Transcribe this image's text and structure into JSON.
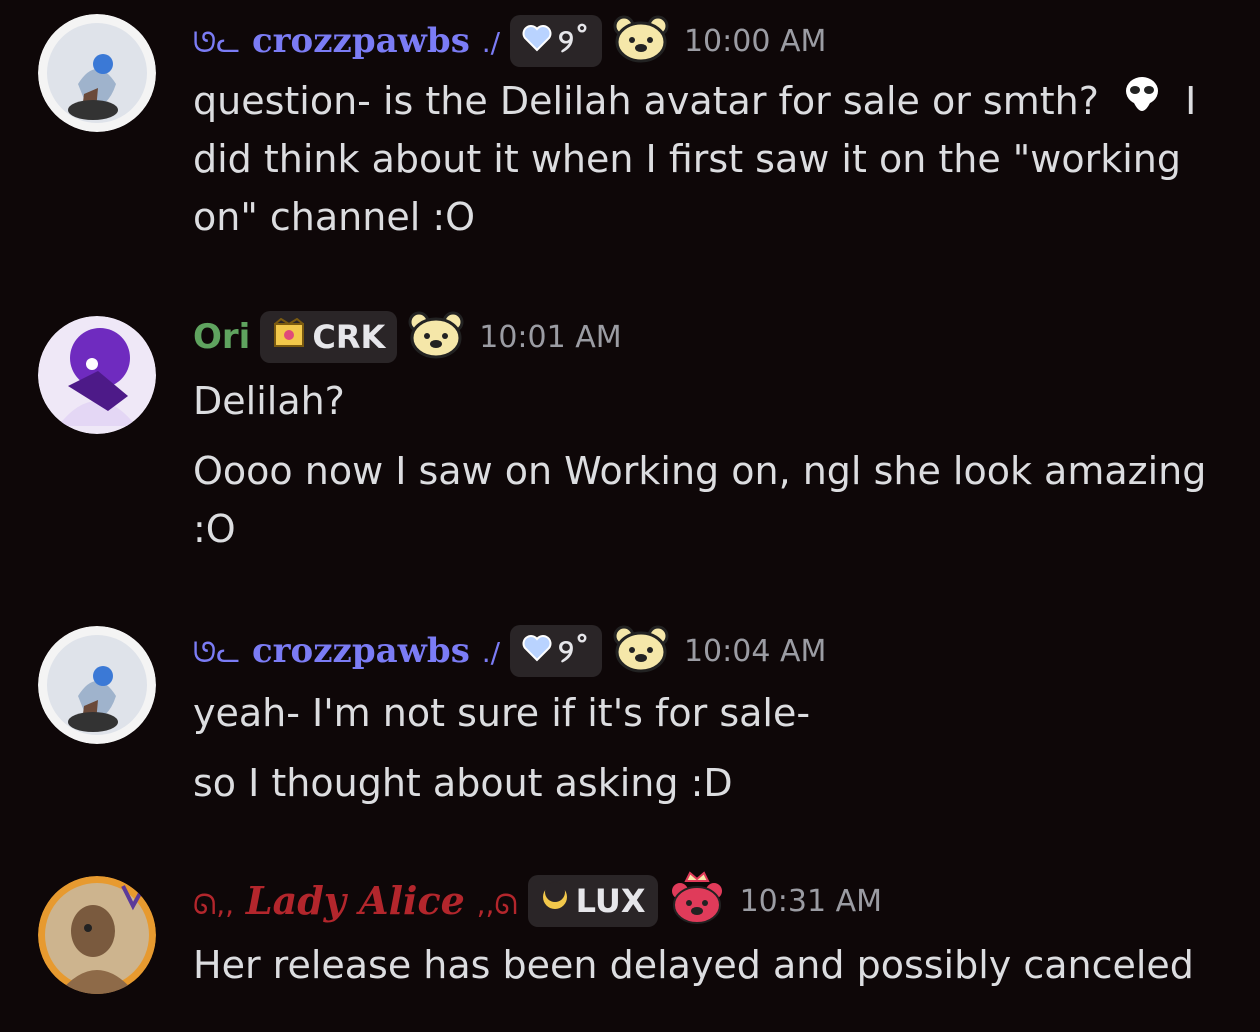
{
  "messages": [
    {
      "username": "crozzpawbs",
      "username_prefix": "ᘎᓚ",
      "username_suffix": "./",
      "name_color": "#7b7cf5",
      "tag_text": "୨˚",
      "tag_icon": "heart-icon",
      "badge_icon": "bear-face-icon",
      "time": "10:00 AM",
      "lines": [
        "question- is the Delilah avatar for sale or smth?",
        "I",
        "did think about it when I first saw it on the \"working",
        "on\" channel :O"
      ],
      "inline_emoji": "ghost-emoji"
    },
    {
      "username": "Ori",
      "name_color": "#5fa35f",
      "tag_text": "CRK",
      "tag_icon": "crown-icon",
      "badge_icon": "bear-face-icon",
      "time": "10:01 AM",
      "lines": [
        "Delilah?",
        "Oooo now I saw on Working on, ngl she look amazing",
        ":O"
      ]
    },
    {
      "username": "crozzpawbs",
      "username_prefix": "ᘎᓚ",
      "username_suffix": "./",
      "name_color": "#7b7cf5",
      "tag_text": "୨˚",
      "tag_icon": "heart-icon",
      "badge_icon": "bear-face-icon",
      "time": "10:04 AM",
      "lines": [
        "yeah- I'm not sure if it's for sale-",
        "so I thought about asking :D"
      ]
    },
    {
      "username": "Lady Alice",
      "username_prefix": "ᘏ,,",
      "username_suffix": ",,ᘏ",
      "name_color": "#b3262c",
      "tag_text": "LUX",
      "tag_icon": "moon-icon",
      "badge_icon": "crowned-bear-icon",
      "time": "10:31 AM",
      "lines": [
        "Her release has been delayed and possibly canceled"
      ]
    }
  ]
}
